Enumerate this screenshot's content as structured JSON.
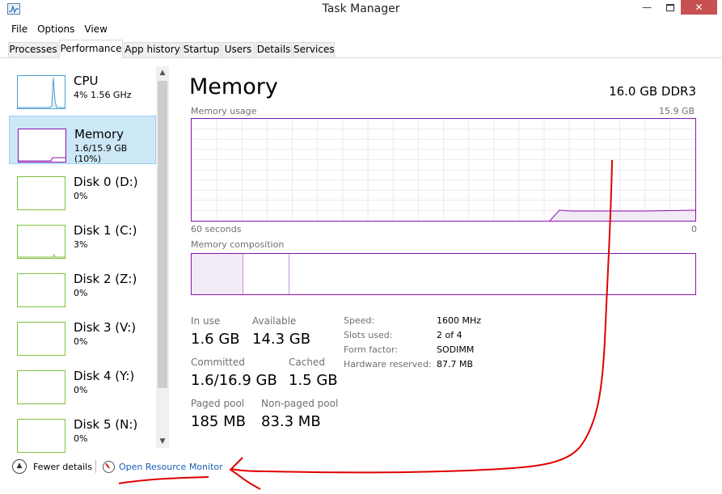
{
  "window": {
    "title": "Task Manager",
    "minimize": "—",
    "close": "✕"
  },
  "menu": [
    "File",
    "Options",
    "View"
  ],
  "tabs": [
    "Processes",
    "Performance",
    "App history",
    "Startup",
    "Users",
    "Details",
    "Services"
  ],
  "active_tab": "Performance",
  "sidebar": [
    {
      "name": "CPU",
      "sub": "4%  1.56 GHz",
      "color": "#4b9ed6"
    },
    {
      "name": "Memory",
      "sub": "1.6/15.9 GB (10%)",
      "color": "#8b12ae",
      "selected": true
    },
    {
      "name": "Disk 0 (D:)",
      "sub": "0%",
      "color": "#7dc240"
    },
    {
      "name": "Disk 1 (C:)",
      "sub": "3%",
      "color": "#7dc240"
    },
    {
      "name": "Disk 2 (Z:)",
      "sub": "0%",
      "color": "#7dc240"
    },
    {
      "name": "Disk 3 (V:)",
      "sub": "0%",
      "color": "#7dc240"
    },
    {
      "name": "Disk 4 (Y:)",
      "sub": "0%",
      "color": "#7dc240"
    },
    {
      "name": "Disk 5 (N:)",
      "sub": "0%",
      "color": "#7dc240"
    }
  ],
  "main": {
    "title": "Memory",
    "spec": "16.0 GB DDR3",
    "usage_label": "Memory usage",
    "usage_max": "15.9 GB",
    "time_left": "60 seconds",
    "time_right": "0",
    "composition_label": "Memory composition",
    "stats": {
      "in_use_label": "In use",
      "in_use": "1.6 GB",
      "available_label": "Available",
      "available": "14.3 GB",
      "committed_label": "Committed",
      "committed": "1.6/16.9 GB",
      "cached_label": "Cached",
      "cached": "1.5 GB",
      "paged_label": "Paged pool",
      "paged": "185 MB",
      "nonpaged_label": "Non-paged pool",
      "nonpaged": "83.3 MB"
    },
    "specs": [
      {
        "label": "Speed:",
        "value": "1600 MHz"
      },
      {
        "label": "Slots used:",
        "value": "2 of 4"
      },
      {
        "label": "Form factor:",
        "value": "SODIMM"
      },
      {
        "label": "Hardware reserved:",
        "value": "87.7 MB"
      }
    ]
  },
  "footer": {
    "fewer_details": "Fewer details",
    "open_resource_monitor": "Open Resource Monitor"
  },
  "colors": {
    "memory": "#8b12ae",
    "cpu": "#4b9ed6",
    "disk": "#7dc240",
    "selected": "#cce8f7",
    "link": "#1a5fb4",
    "annotation": "#e00000"
  }
}
